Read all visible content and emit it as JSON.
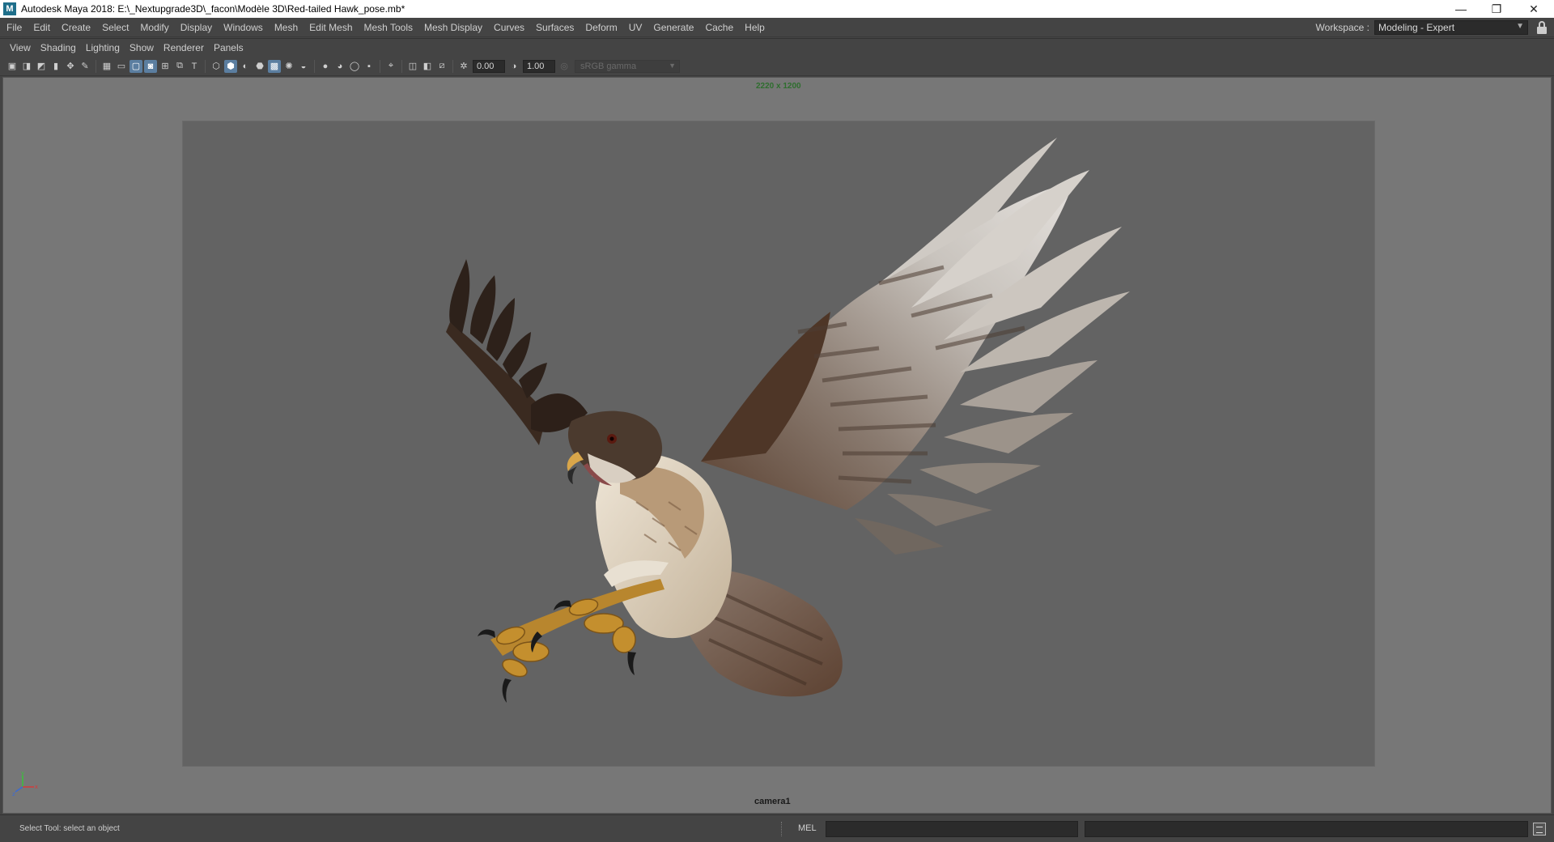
{
  "window": {
    "app_icon": "M",
    "title": "Autodesk Maya 2018: E:\\_Nextupgrade3D\\_facon\\Modèle 3D\\Red-tailed Hawk_pose.mb*",
    "minimize": "—",
    "restore": "❐",
    "close": "✕"
  },
  "menubar": {
    "items": [
      "File",
      "Edit",
      "Create",
      "Select",
      "Modify",
      "Display",
      "Windows",
      "Mesh",
      "Edit Mesh",
      "Mesh Tools",
      "Mesh Display",
      "Curves",
      "Surfaces",
      "Deform",
      "UV",
      "Generate",
      "Cache",
      "Help"
    ]
  },
  "workspace": {
    "label": "Workspace :",
    "value": "Modeling - Expert",
    "arrow": "▼"
  },
  "panel_menu": {
    "items": [
      "View",
      "Shading",
      "Lighting",
      "Show",
      "Renderer",
      "Panels"
    ]
  },
  "panel_toolbar": {
    "exposure": "0.00",
    "gamma": "1.00",
    "color_space": "sRGB gamma",
    "arrow": "▼",
    "icons": [
      "camera-icon",
      "lock-camera-icon",
      "bookmark-icon",
      "image-plane-icon",
      "two-d-pan-icon",
      "grease-pencil-icon",
      "grid-icon",
      "film-gate-icon",
      "resolution-gate-icon",
      "gate-mask-icon",
      "field-chart-icon",
      "safe-action-icon",
      "safe-title-icon",
      "wireframe-icon",
      "smooth-shade-icon",
      "default-lighting-icon",
      "wireframe-on-shaded-icon",
      "textured-icon",
      "use-lights-icon",
      "shadows-icon",
      "screen-space-ao-icon",
      "motion-blur-icon",
      "multisample-aa-icon",
      "depth-of-field-icon",
      "isolate-select-icon",
      "xray-icon",
      "xray-joints-icon",
      "xray-components-icon"
    ]
  },
  "viewport": {
    "resolution": "2220 x 1200",
    "camera": "camera1",
    "axis_labels": {
      "x": "x",
      "y": "y",
      "z": "z"
    }
  },
  "command_line": {
    "help": "Select Tool: select an object",
    "mode": "MEL"
  }
}
